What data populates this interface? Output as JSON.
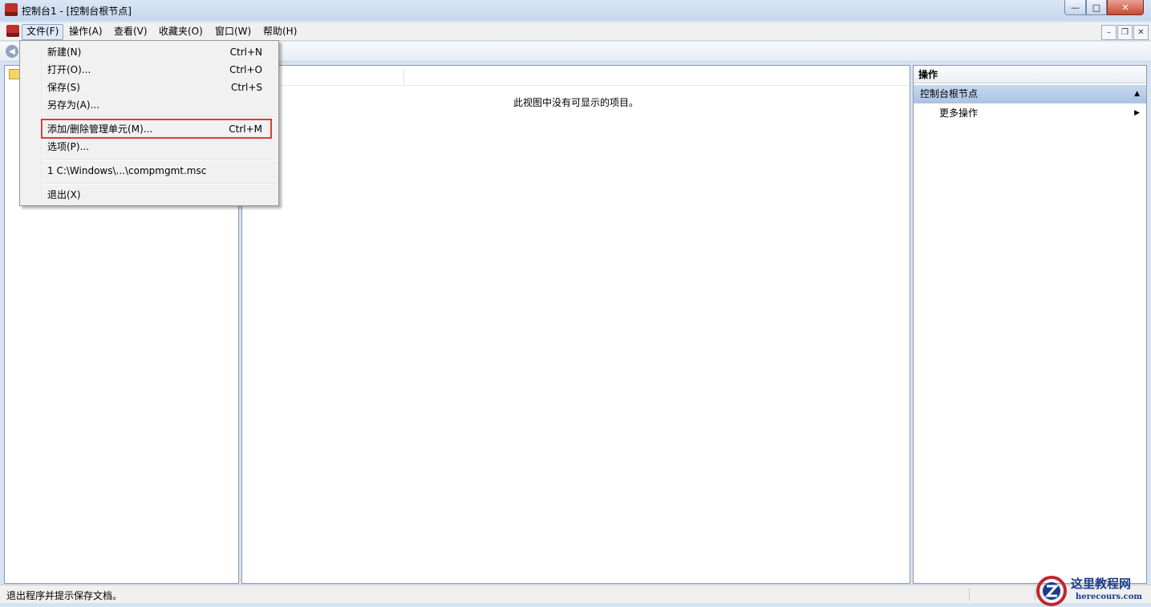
{
  "window": {
    "title": "控制台1 - [控制台根节点]",
    "min_glyph": "—",
    "max_glyph": "□",
    "close_glyph": "✕"
  },
  "menubar": {
    "items": [
      "文件(F)",
      "操作(A)",
      "查看(V)",
      "收藏夹(O)",
      "窗口(W)",
      "帮助(H)"
    ],
    "open_item": "文件(F)"
  },
  "mdi_buttons": {
    "min": "–",
    "restore": "❐",
    "close": "✕"
  },
  "toolbar": {
    "back_glyph": "◀"
  },
  "center": {
    "empty_message": "此视图中没有可显示的项目。"
  },
  "actions_pane": {
    "header": "操作",
    "section_title": "控制台根节点",
    "section_caret": "▲",
    "items": [
      {
        "label": "更多操作",
        "arrow": "▶"
      }
    ]
  },
  "file_menu": {
    "items": [
      {
        "label": "新建(N)",
        "shortcut": "Ctrl+N"
      },
      {
        "label": "打开(O)...",
        "shortcut": "Ctrl+O"
      },
      {
        "label": "保存(S)",
        "shortcut": "Ctrl+S"
      },
      {
        "label": "另存为(A)...",
        "shortcut": ""
      },
      {
        "label": "添加/删除管理单元(M)...",
        "shortcut": "Ctrl+M"
      },
      {
        "label": "选项(P)...",
        "shortcut": ""
      },
      {
        "label": "1 C:\\Windows\\...\\compmgmt.msc",
        "shortcut": ""
      },
      {
        "label": "退出(X)",
        "shortcut": ""
      }
    ],
    "highlighted_item": "添加/删除管理单元(M)...",
    "highlight_color": "#e03b3b"
  },
  "statusbar": {
    "text": "退出程序并提示保存文档。"
  },
  "watermark": {
    "title": "这里教程网",
    "subtitle": "herecours.com"
  }
}
